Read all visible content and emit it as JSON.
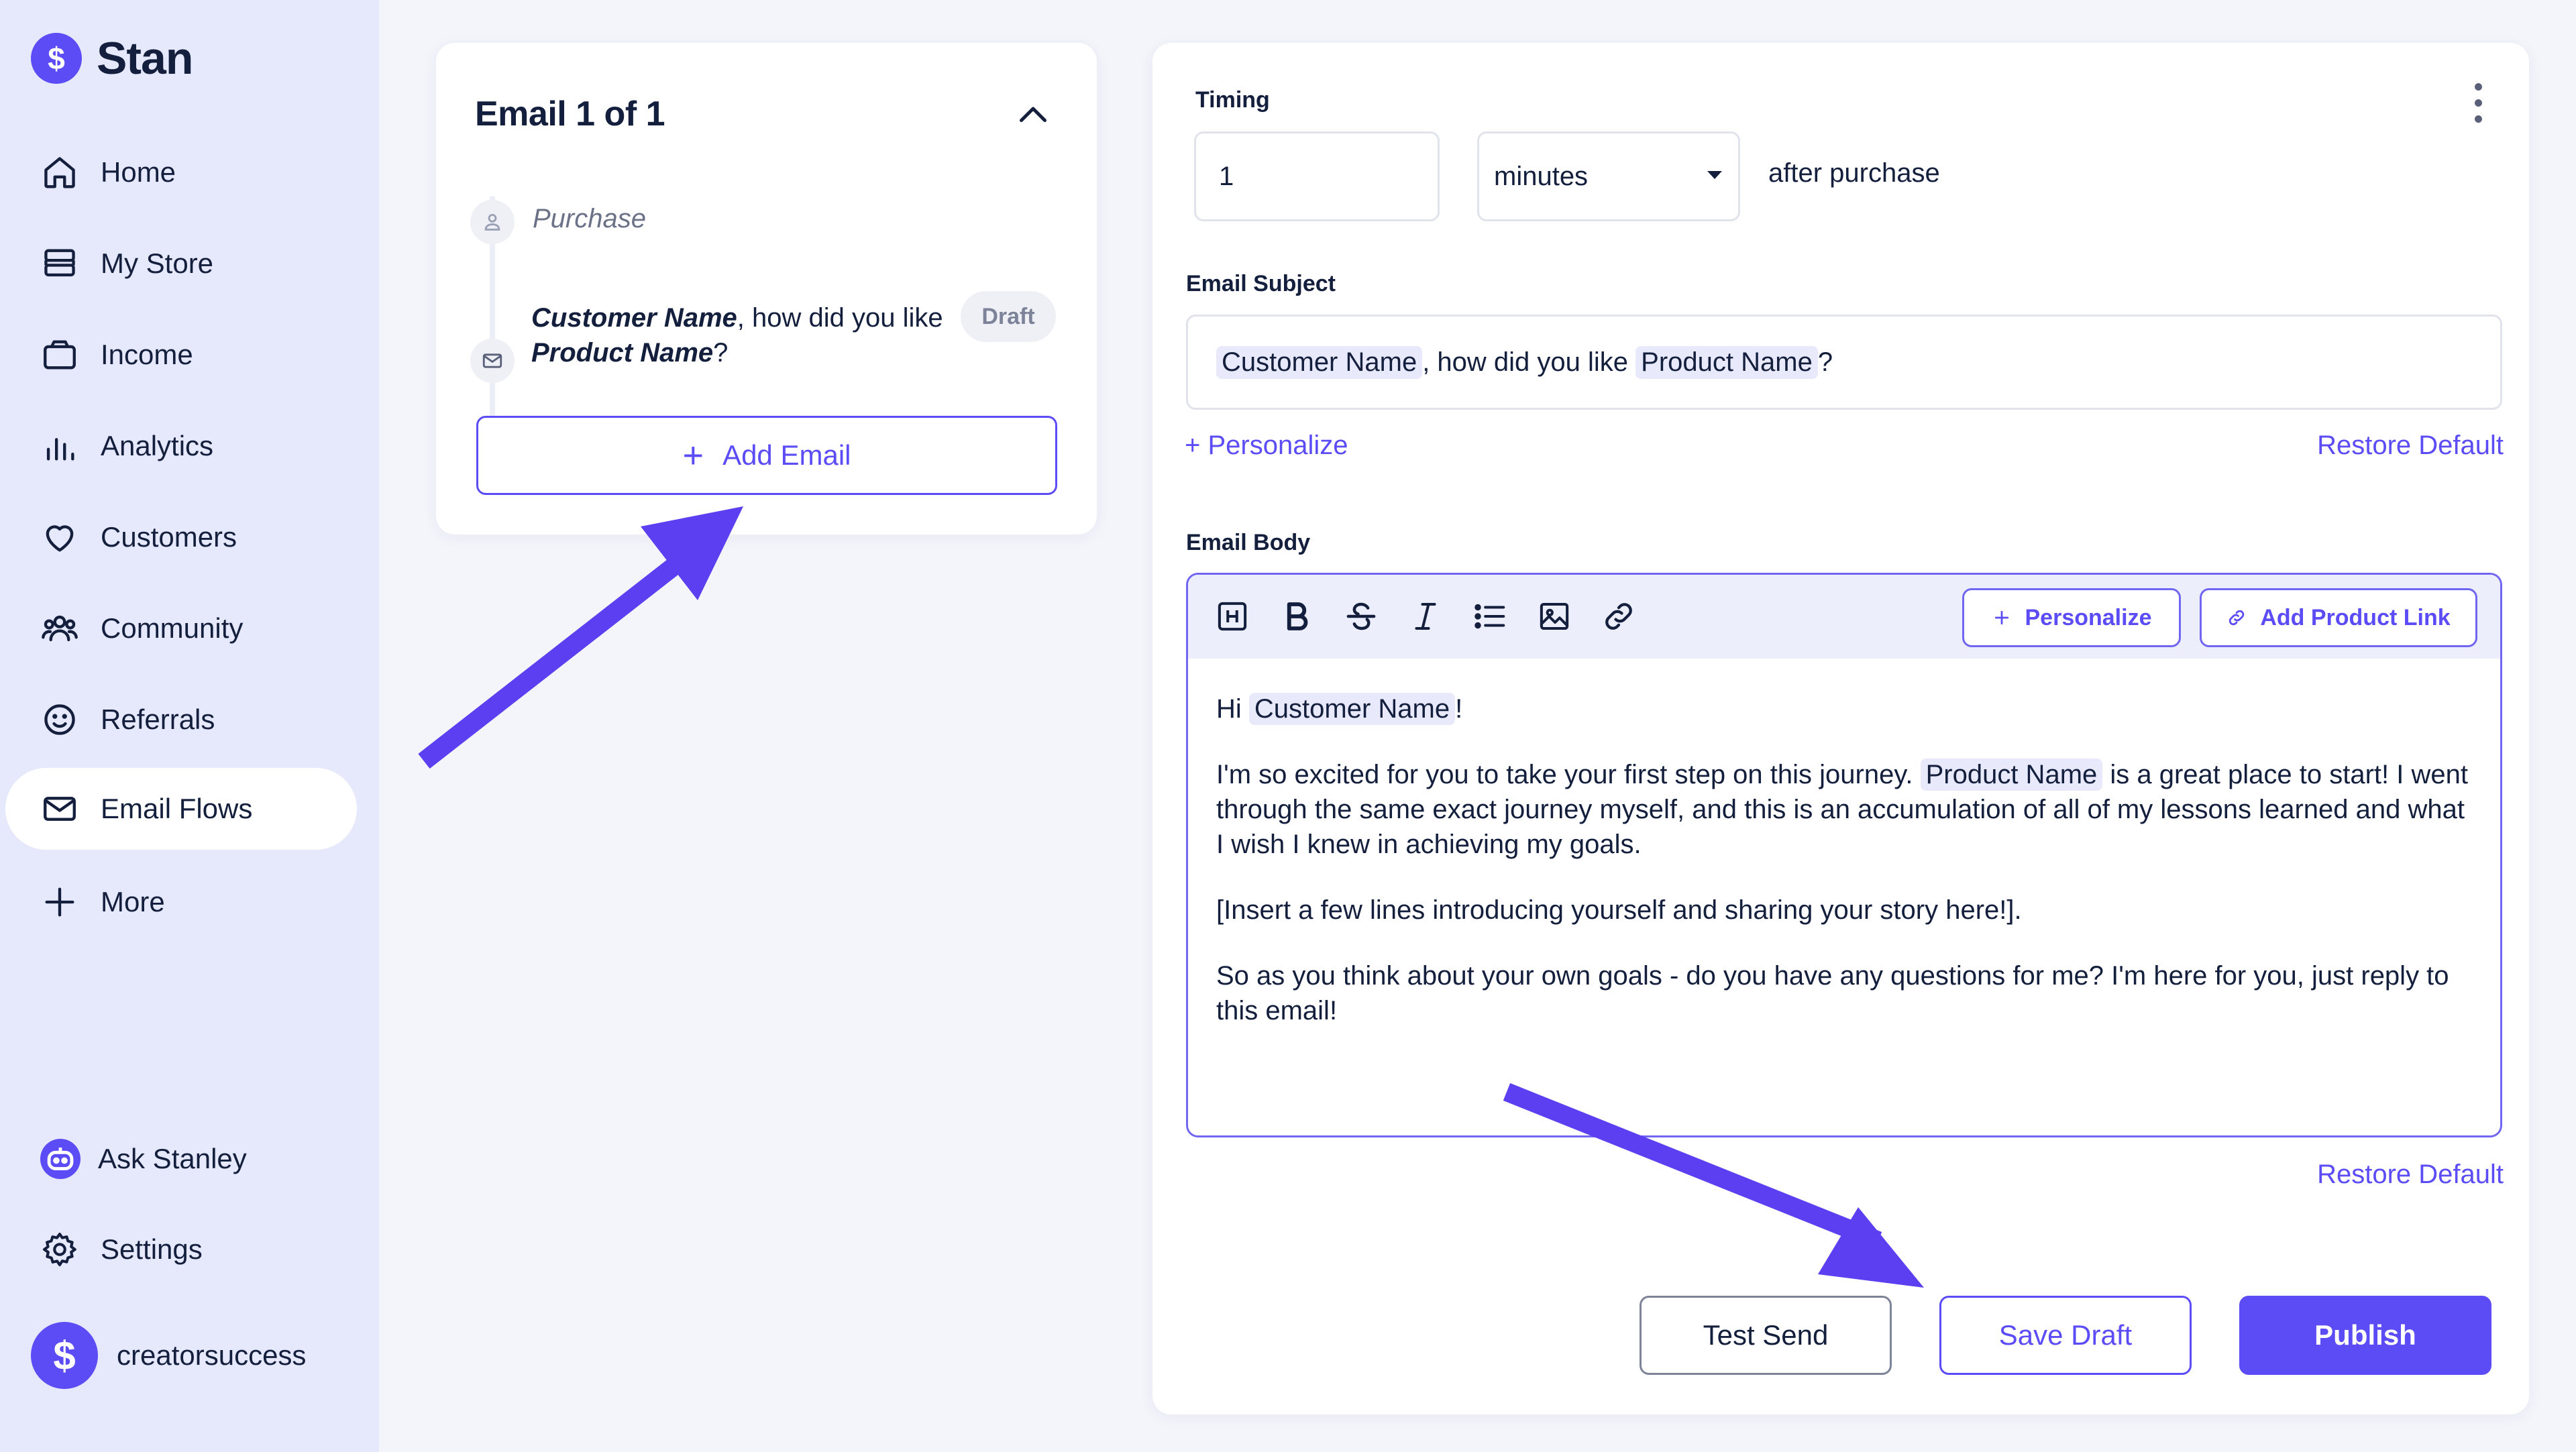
{
  "brand": {
    "name": "Stan",
    "logo_glyph": "$",
    "accent": "#5b4cf5"
  },
  "sidebar": {
    "items": [
      {
        "label": "Home",
        "icon": "home-icon"
      },
      {
        "label": "My Store",
        "icon": "store-icon"
      },
      {
        "label": "Income",
        "icon": "wallet-icon"
      },
      {
        "label": "Analytics",
        "icon": "bar-chart-icon"
      },
      {
        "label": "Customers",
        "icon": "heart-icon"
      },
      {
        "label": "Community",
        "icon": "users-icon"
      },
      {
        "label": "Referrals",
        "icon": "smiley-icon"
      },
      {
        "label": "Email Flows",
        "icon": "mail-icon",
        "active": true
      },
      {
        "label": "More",
        "icon": "plus-icon"
      }
    ],
    "bottom": {
      "ask": {
        "label": "Ask Stanley",
        "icon": "robot-icon"
      },
      "settings": {
        "label": "Settings",
        "icon": "gear-icon"
      },
      "account": {
        "label": "creatorsuccess",
        "glyph": "$"
      }
    }
  },
  "flow": {
    "title": "Email 1 of 1",
    "trigger_label": "Purchase",
    "email_step": {
      "name_token": "Customer Name",
      "text_mid": ", how did you like ",
      "product_token": "Product Name",
      "text_end": "?",
      "status": "Draft"
    },
    "add_email_label": "Add Email"
  },
  "editor": {
    "timing": {
      "label": "Timing",
      "value": "1",
      "unit": "minutes",
      "after": "after purchase"
    },
    "subject": {
      "label": "Email Subject",
      "token_name": "Customer Name",
      "mid": ", how did you like ",
      "token_product": "Product Name",
      "end": "?"
    },
    "personalize_link": "+ Personalize",
    "restore_default": "Restore Default",
    "body": {
      "label": "Email Body",
      "toolbar": {
        "personalize_btn": "Personalize",
        "add_product_link_btn": "Add Product Link"
      },
      "greeting_start": "Hi ",
      "greeting_token": "Customer Name",
      "greeting_end": "!",
      "p1_start": "I'm so excited for you to take your first step on this journey. ",
      "p1_token": "Product Name",
      "p1_end": " is a great place to start! I went through the same exact journey myself, and this is an accumulation of all of my lessons learned and what I wish I knew in achieving my goals.",
      "p2": "[Insert a few lines introducing yourself and sharing your story here!].",
      "p3": "So as you think about your own goals - do you have any questions for me? I'm here for you, just reply to this email!"
    },
    "buttons": {
      "test_send": "Test Send",
      "save_draft": "Save Draft",
      "publish": "Publish"
    }
  },
  "annotation_color": "#5b3ff0"
}
